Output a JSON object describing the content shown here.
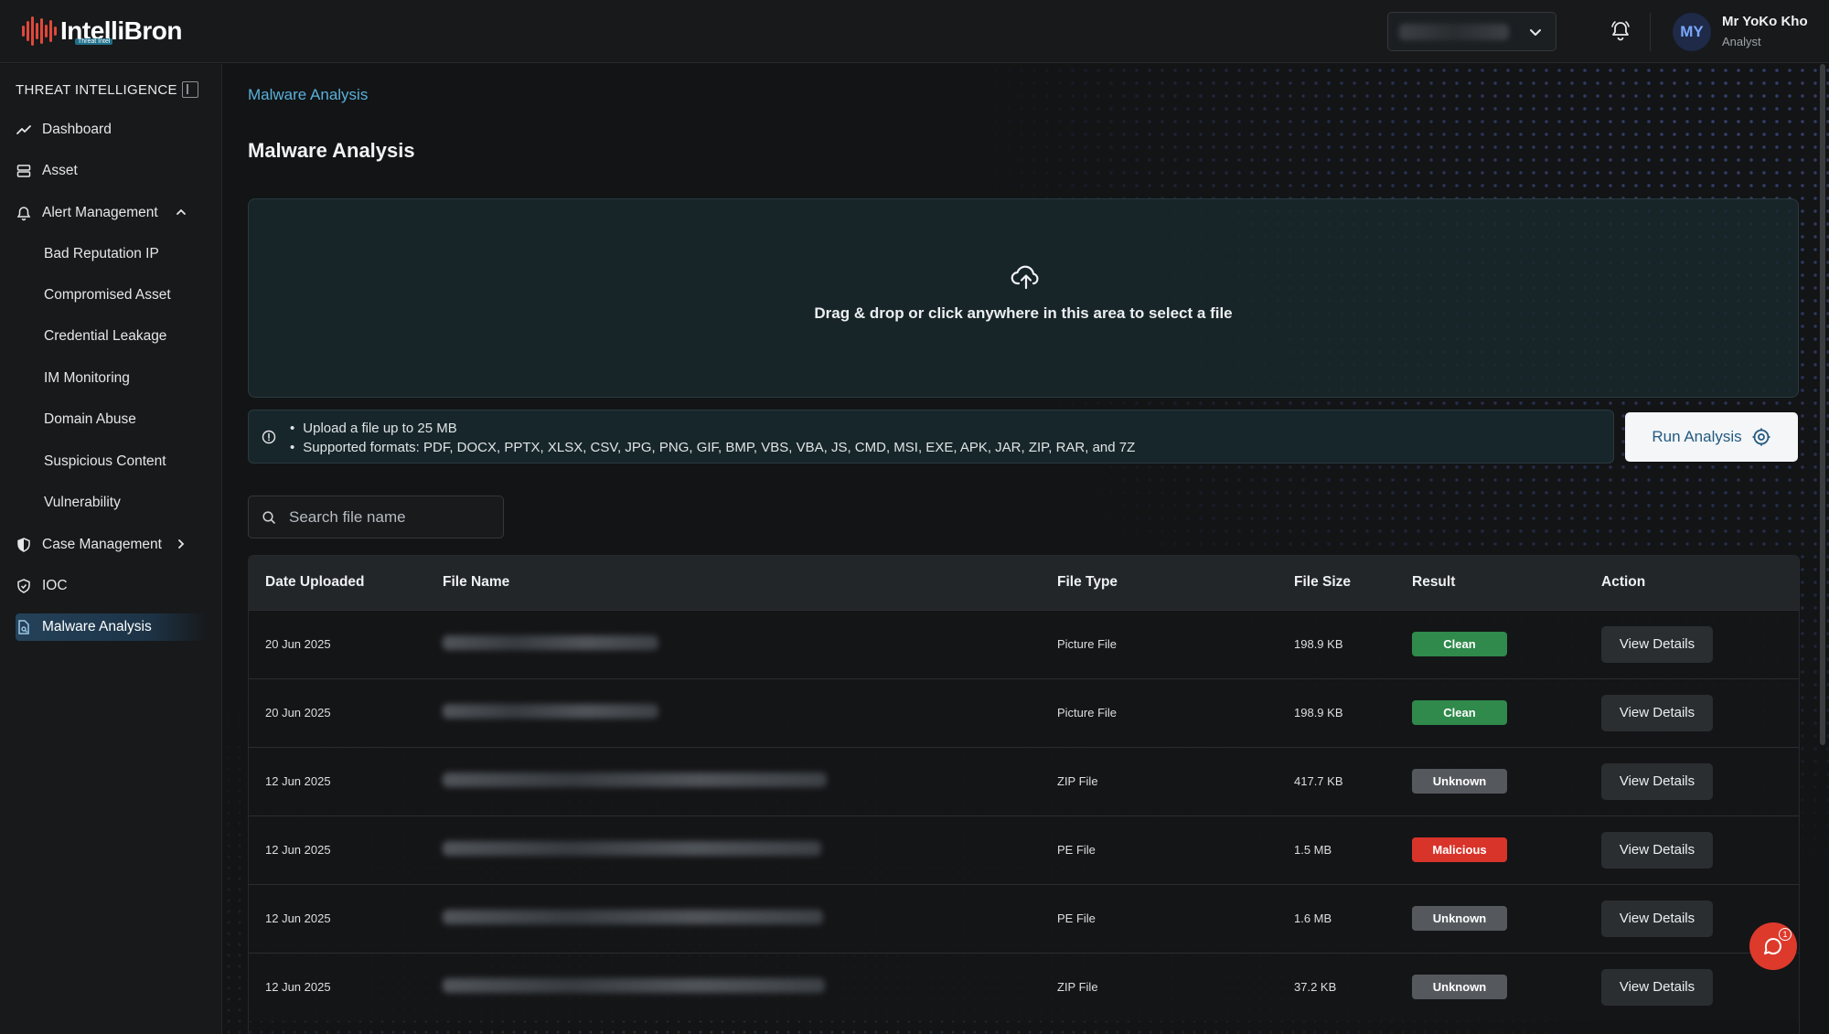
{
  "app": {
    "logo_text": "IntelliBron",
    "logo_tagline": "Threat Intel"
  },
  "header": {
    "tenant_selected": "",
    "user": {
      "initials": "MY",
      "name": "Mr YoKo Kho",
      "role": "Analyst"
    }
  },
  "sidebar": {
    "section_title": "THREAT INTELLIGENCE",
    "items": [
      {
        "label": "Dashboard",
        "icon": "trend-line-icon"
      },
      {
        "label": "Asset",
        "icon": "server-icon"
      },
      {
        "label": "Alert Management",
        "icon": "alarm-icon",
        "expanded": true
      },
      {
        "label": "Bad Reputation IP"
      },
      {
        "label": "Compromised Asset"
      },
      {
        "label": "Credential Leakage"
      },
      {
        "label": "IM Monitoring"
      },
      {
        "label": "Domain Abuse"
      },
      {
        "label": "Suspicious Content"
      },
      {
        "label": "Vulnerability"
      },
      {
        "label": "Case Management",
        "icon": "shield-half-icon",
        "expanded": false
      },
      {
        "label": "IOC",
        "icon": "shield-check-icon"
      },
      {
        "label": "Malware Analysis",
        "icon": "file-search-icon",
        "active": true
      }
    ]
  },
  "main": {
    "breadcrumb": "Malware Analysis",
    "title": "Malware Analysis",
    "dropzone_text": "Drag & drop or click anywhere in this area to select a file",
    "info": [
      "Upload a file up to 25 MB",
      "Supported formats: PDF, DOCX, PPTX, XLSX, CSV, JPG, PNG, GIF, BMP, VBS, VBA, JS, CMD, MSI, EXE, APK, JAR, ZIP, RAR, and 7Z"
    ],
    "run_button": "Run Analysis",
    "search_placeholder": "Search file name",
    "table": {
      "columns": [
        "Date Uploaded",
        "File Name",
        "File Type",
        "File Size",
        "Result",
        "Action"
      ],
      "rows": [
        {
          "date": "20 Jun 2025",
          "type": "Picture File",
          "size": "198.9 KB",
          "result": "Clean",
          "action": "View Details"
        },
        {
          "date": "20 Jun 2025",
          "type": "Picture File",
          "size": "198.9 KB",
          "result": "Clean",
          "action": "View Details"
        },
        {
          "date": "12 Jun 2025",
          "type": "ZIP File",
          "size": "417.7 KB",
          "result": "Unknown",
          "action": "View Details"
        },
        {
          "date": "12 Jun 2025",
          "type": "PE File",
          "size": "1.5 MB",
          "result": "Malicious",
          "action": "View Details"
        },
        {
          "date": "12 Jun 2025",
          "type": "PE File",
          "size": "1.6 MB",
          "result": "Unknown",
          "action": "View Details"
        },
        {
          "date": "12 Jun 2025",
          "type": "ZIP File",
          "size": "37.2 KB",
          "result": "Unknown",
          "action": "View Details"
        }
      ]
    }
  },
  "chat": {
    "unread_count": "1"
  },
  "colors": {
    "accent": "#5ab0d8",
    "clean": "#2f8a4b",
    "unknown": "#55595e",
    "malicious": "#d8342a",
    "brand": "#e0483a"
  }
}
